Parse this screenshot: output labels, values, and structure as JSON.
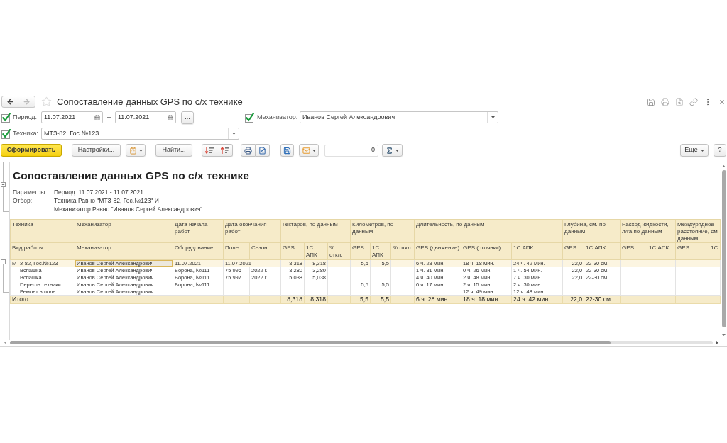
{
  "window": {
    "title": "Сопоставление данных GPS по с/х технике",
    "favorite": false,
    "navigation": {
      "back": {
        "disabled": false
      },
      "forward": {
        "disabled": true
      }
    }
  },
  "filters": {
    "period": {
      "checked": true,
      "label": "Период:",
      "from": "11.07.2021",
      "dash": "–",
      "to": "11.07.2021",
      "button": "..."
    },
    "mechanic": {
      "checked": true,
      "label": "Механизатор:",
      "value": "Иванов Сергей Александрович"
    },
    "equipment": {
      "checked": true,
      "label": "Техника:",
      "value": "МТЗ-82, Гос.№123"
    }
  },
  "toolbar": {
    "generate": "Сформировать",
    "settings": "Настройки...",
    "find": "Найти...",
    "counter": "0",
    "more": "Еще",
    "help": "?"
  },
  "report": {
    "title": "Сопоставление данных GPS по с/х технике",
    "parameters": {
      "expanded": true,
      "items": [
        {
          "label": "Параметры:",
          "lines": [
            "Период: 11.07.2021 - 11.07.2021"
          ]
        },
        {
          "label": "Отбор:",
          "lines": [
            "Техника Равно \"МТЗ-82, Гос.№123\" И",
            "Механизатор Равно \"Иванов Сергей Александрович\""
          ]
        }
      ]
    },
    "table": {
      "header": [
        {
          "title": "Техника",
          "columns": [
            "Вид работы"
          ]
        },
        {
          "title": "Механизатор",
          "columns": [
            "Механизатор"
          ]
        },
        {
          "title": "Дата начала работ",
          "columns": [
            "Оборудование"
          ]
        },
        {
          "title": "Дата окончания работ",
          "columns": [
            "Поле",
            "Сезон"
          ]
        },
        {
          "title": "Гектаров, по данным",
          "columns": [
            "GPS",
            "1С АПК",
            "% откл."
          ]
        },
        {
          "title": "Километров, по данным",
          "columns": [
            "GPS",
            "1С АПК",
            "% откл."
          ]
        },
        {
          "title": "Длительность, по данным",
          "columns": [
            "GPS (движение)",
            "GPS (стоянки)",
            "1С АПК"
          ]
        },
        {
          "title": "Глубина, см. по данным",
          "columns": [
            "GPS",
            "1С АПК"
          ]
        },
        {
          "title": "Расход жидкости, л/га по данным",
          "columns": [
            "GPS",
            "1С АПК"
          ]
        },
        {
          "title": "Междурядное расстояние, см данным",
          "columns": [
            "GPS",
            "1С"
          ]
        }
      ],
      "rows": [
        {
          "kind": "group",
          "expanded": true,
          "selected": true,
          "cells": {
            "technique": "МТЗ-82, Гос.№123",
            "mechanic": "Иванов Сергей Александрович",
            "start": "11.07.2021",
            "end": "11.07.2021",
            "ha_gps": "8,318",
            "ha_apk": "8,318",
            "km_gps": "5,5",
            "km_apk": "5,5",
            "move": "6 ч. 28 мин.",
            "stop": "18 ч. 18 мин.",
            "time_apk": "24 ч. 42 мин.",
            "depth_gps": "22,0",
            "depth_apk": "22-30 см."
          },
          "children": [
            {
              "kind": "detail",
              "selected": false,
              "cells": {
                "work": "Вспашка",
                "mechanic": "Иванов Сергей Александрович",
                "equipment": "Борона, №111",
                "field": "75 996",
                "season": "2022 г.",
                "ha_gps": "3,280",
                "ha_apk": "3,280",
                "move": "1 ч. 31 мин.",
                "stop": "0 ч. 26 мин.",
                "time_apk": "1 ч. 54 мин.",
                "depth_gps": "22,0",
                "depth_apk": "22-30 см."
              }
            },
            {
              "kind": "detail",
              "selected": false,
              "cells": {
                "work": "Вспашка",
                "mechanic": "Иванов Сергей Александрович",
                "equipment": "Борона, №111",
                "field": "75 997",
                "season": "2022 г.",
                "ha_gps": "5,038",
                "ha_apk": "5,038",
                "move": "4 ч. 40 мин.",
                "stop": "2 ч. 48 мин.",
                "time_apk": "7 ч. 30 мин.",
                "depth_gps": "22,0",
                "depth_apk": "22-30 см."
              }
            },
            {
              "kind": "detail",
              "selected": false,
              "cells": {
                "work": "Перегон техники",
                "mechanic": "Иванов Сергей Александрович",
                "equipment": "Борона, №111",
                "km_gps": "5,5",
                "km_apk": "5,5",
                "move": "0 ч. 17 мин.",
                "stop": "2 ч. 15 мин.",
                "time_apk": "2 ч. 30 мин."
              }
            },
            {
              "kind": "detail",
              "selected": false,
              "cells": {
                "work": "Ремонт в поле",
                "mechanic": "Иванов Сергей Александрович",
                "stop": "12 ч. 49 мин.",
                "time_apk": "12 ч. 48 мин."
              }
            }
          ]
        }
      ],
      "total": {
        "cells": {
          "label": "Итого",
          "ha_gps": "8,318",
          "ha_apk": "8,318",
          "km_gps": "5,5",
          "km_apk": "5,5",
          "move": "6 ч. 28 мин.",
          "stop": "18 ч. 18 мин.",
          "time_apk": "24 ч. 42 мин.",
          "depth_gps": "22,0",
          "depth_apk": "22-30 см."
        }
      }
    }
  }
}
